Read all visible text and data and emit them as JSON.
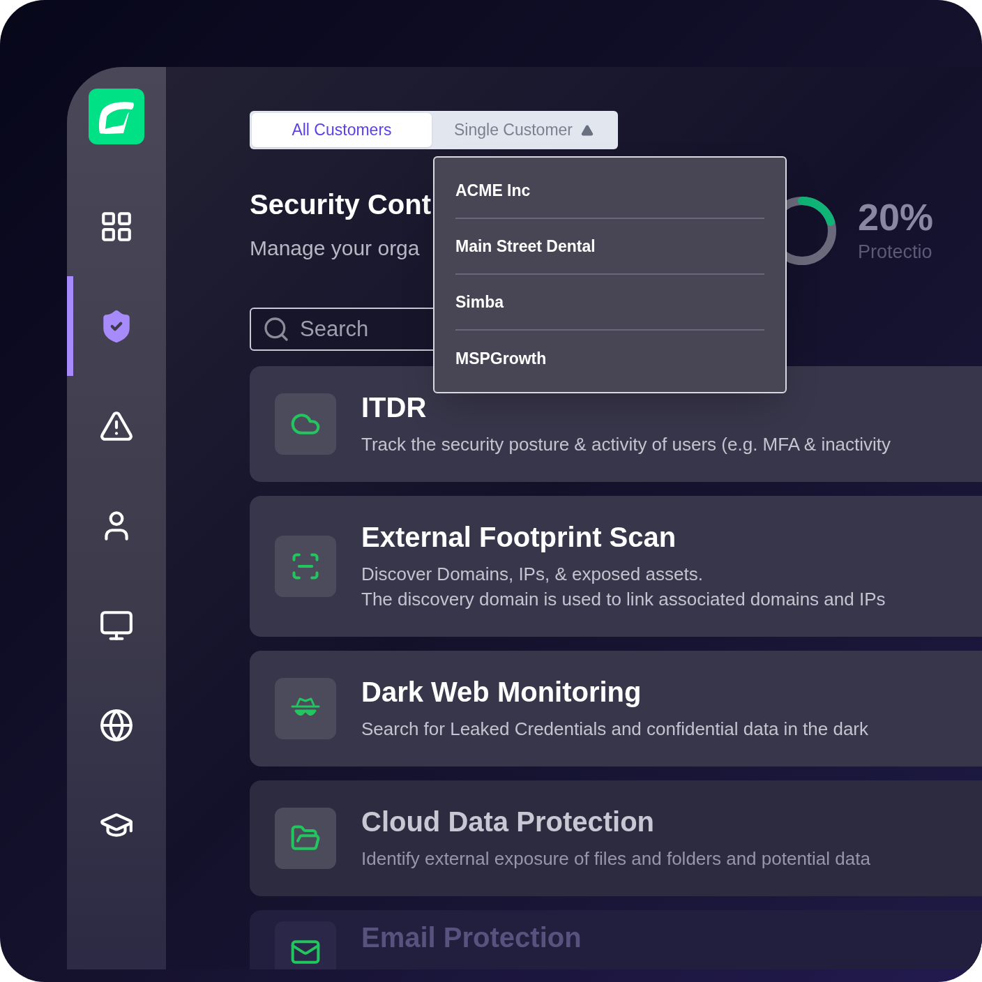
{
  "sidebar": {
    "items": [
      {
        "kind": "dashboard",
        "selected": false
      },
      {
        "kind": "shield",
        "selected": true
      },
      {
        "kind": "alert",
        "selected": false
      },
      {
        "kind": "user",
        "selected": false
      },
      {
        "kind": "monitor",
        "selected": false
      },
      {
        "kind": "globe",
        "selected": false
      },
      {
        "kind": "education",
        "selected": false
      }
    ]
  },
  "tabs": [
    {
      "label": "All Customers",
      "selected": true
    },
    {
      "label": "Single Customer",
      "selected": false,
      "expanded": true
    }
  ],
  "customer_menu": [
    "ACME Inc",
    "Main Street Dental",
    "Simba",
    "MSPGrowth"
  ],
  "title": "Security Cont",
  "subtitle": "Manage your orga",
  "protection": {
    "level": 0.2,
    "value": "20%",
    "label": "Protectio"
  },
  "search": {
    "placeholder": "Search"
  },
  "cards": [
    {
      "kind": "cloud",
      "title": "ITDR",
      "lines": [
        "Track the security posture & activity of users (e.g. MFA & inactivity"
      ]
    },
    {
      "kind": "scan",
      "title": "External Footprint Scan",
      "lines": [
        "Discover Domains, IPs, & exposed assets.",
        "The discovery domain is used to link associated domains and IPs"
      ]
    },
    {
      "kind": "spy",
      "title": "Dark Web Monitoring",
      "lines": [
        "Search for Leaked Credentials and confidential data in the dark"
      ]
    },
    {
      "kind": "folder",
      "title": "Cloud Data Protection",
      "lines": [
        "Identify external exposure of files and folders and potential data"
      ]
    },
    {
      "kind": "mail",
      "title": "Email Protection"
    }
  ]
}
